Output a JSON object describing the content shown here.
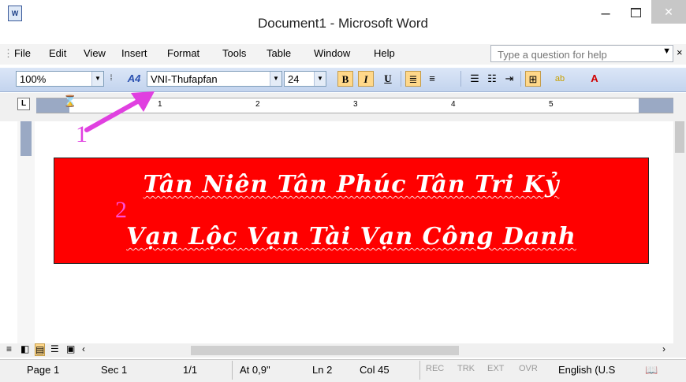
{
  "window": {
    "title": "Document1 - Microsoft Word",
    "app_icon": "word-doc-icon",
    "controls": {
      "minimize": "–",
      "close": "✕"
    }
  },
  "menu": {
    "items": [
      {
        "label": "File",
        "name": "menu-file"
      },
      {
        "label": "Edit",
        "name": "menu-edit"
      },
      {
        "label": "View",
        "name": "menu-view"
      },
      {
        "label": "Insert",
        "name": "menu-insert"
      },
      {
        "label": "Format",
        "name": "menu-format"
      },
      {
        "label": "Tools",
        "name": "menu-tools"
      },
      {
        "label": "Table",
        "name": "menu-table"
      },
      {
        "label": "Window",
        "name": "menu-window"
      },
      {
        "label": "Help",
        "name": "menu-help"
      }
    ],
    "help_placeholder": "Type a question for help",
    "close_glyph": "×"
  },
  "toolbar": {
    "zoom": "100%",
    "style_icon": "A4",
    "font": "VNI-Thufapfan",
    "size": "24",
    "bold": "B",
    "italic": "I",
    "underline": "U"
  },
  "ruler": {
    "tab_selector": "L",
    "numbers": [
      "1",
      "2",
      "3",
      "4",
      "5"
    ]
  },
  "document": {
    "banner_color": "#ff0000",
    "line1": "Tân Niên Tân Phúc Tân Tri Kỷ",
    "line2": "Vạn Lộc Vạn Tài Vạn Công Danh"
  },
  "annotations": {
    "label1": "1",
    "label2": "2",
    "arrow_color": "#e040e0",
    "label2_color": "#ff4fd8"
  },
  "status": {
    "page": "Page 1",
    "sec": "Sec 1",
    "pages": "1/1",
    "at": "At 0,9\"",
    "ln": "Ln 2",
    "col": "Col 45",
    "rec": "REC",
    "trk": "TRK",
    "ext": "EXT",
    "ovr": "OVR",
    "language": "English (U.S"
  }
}
